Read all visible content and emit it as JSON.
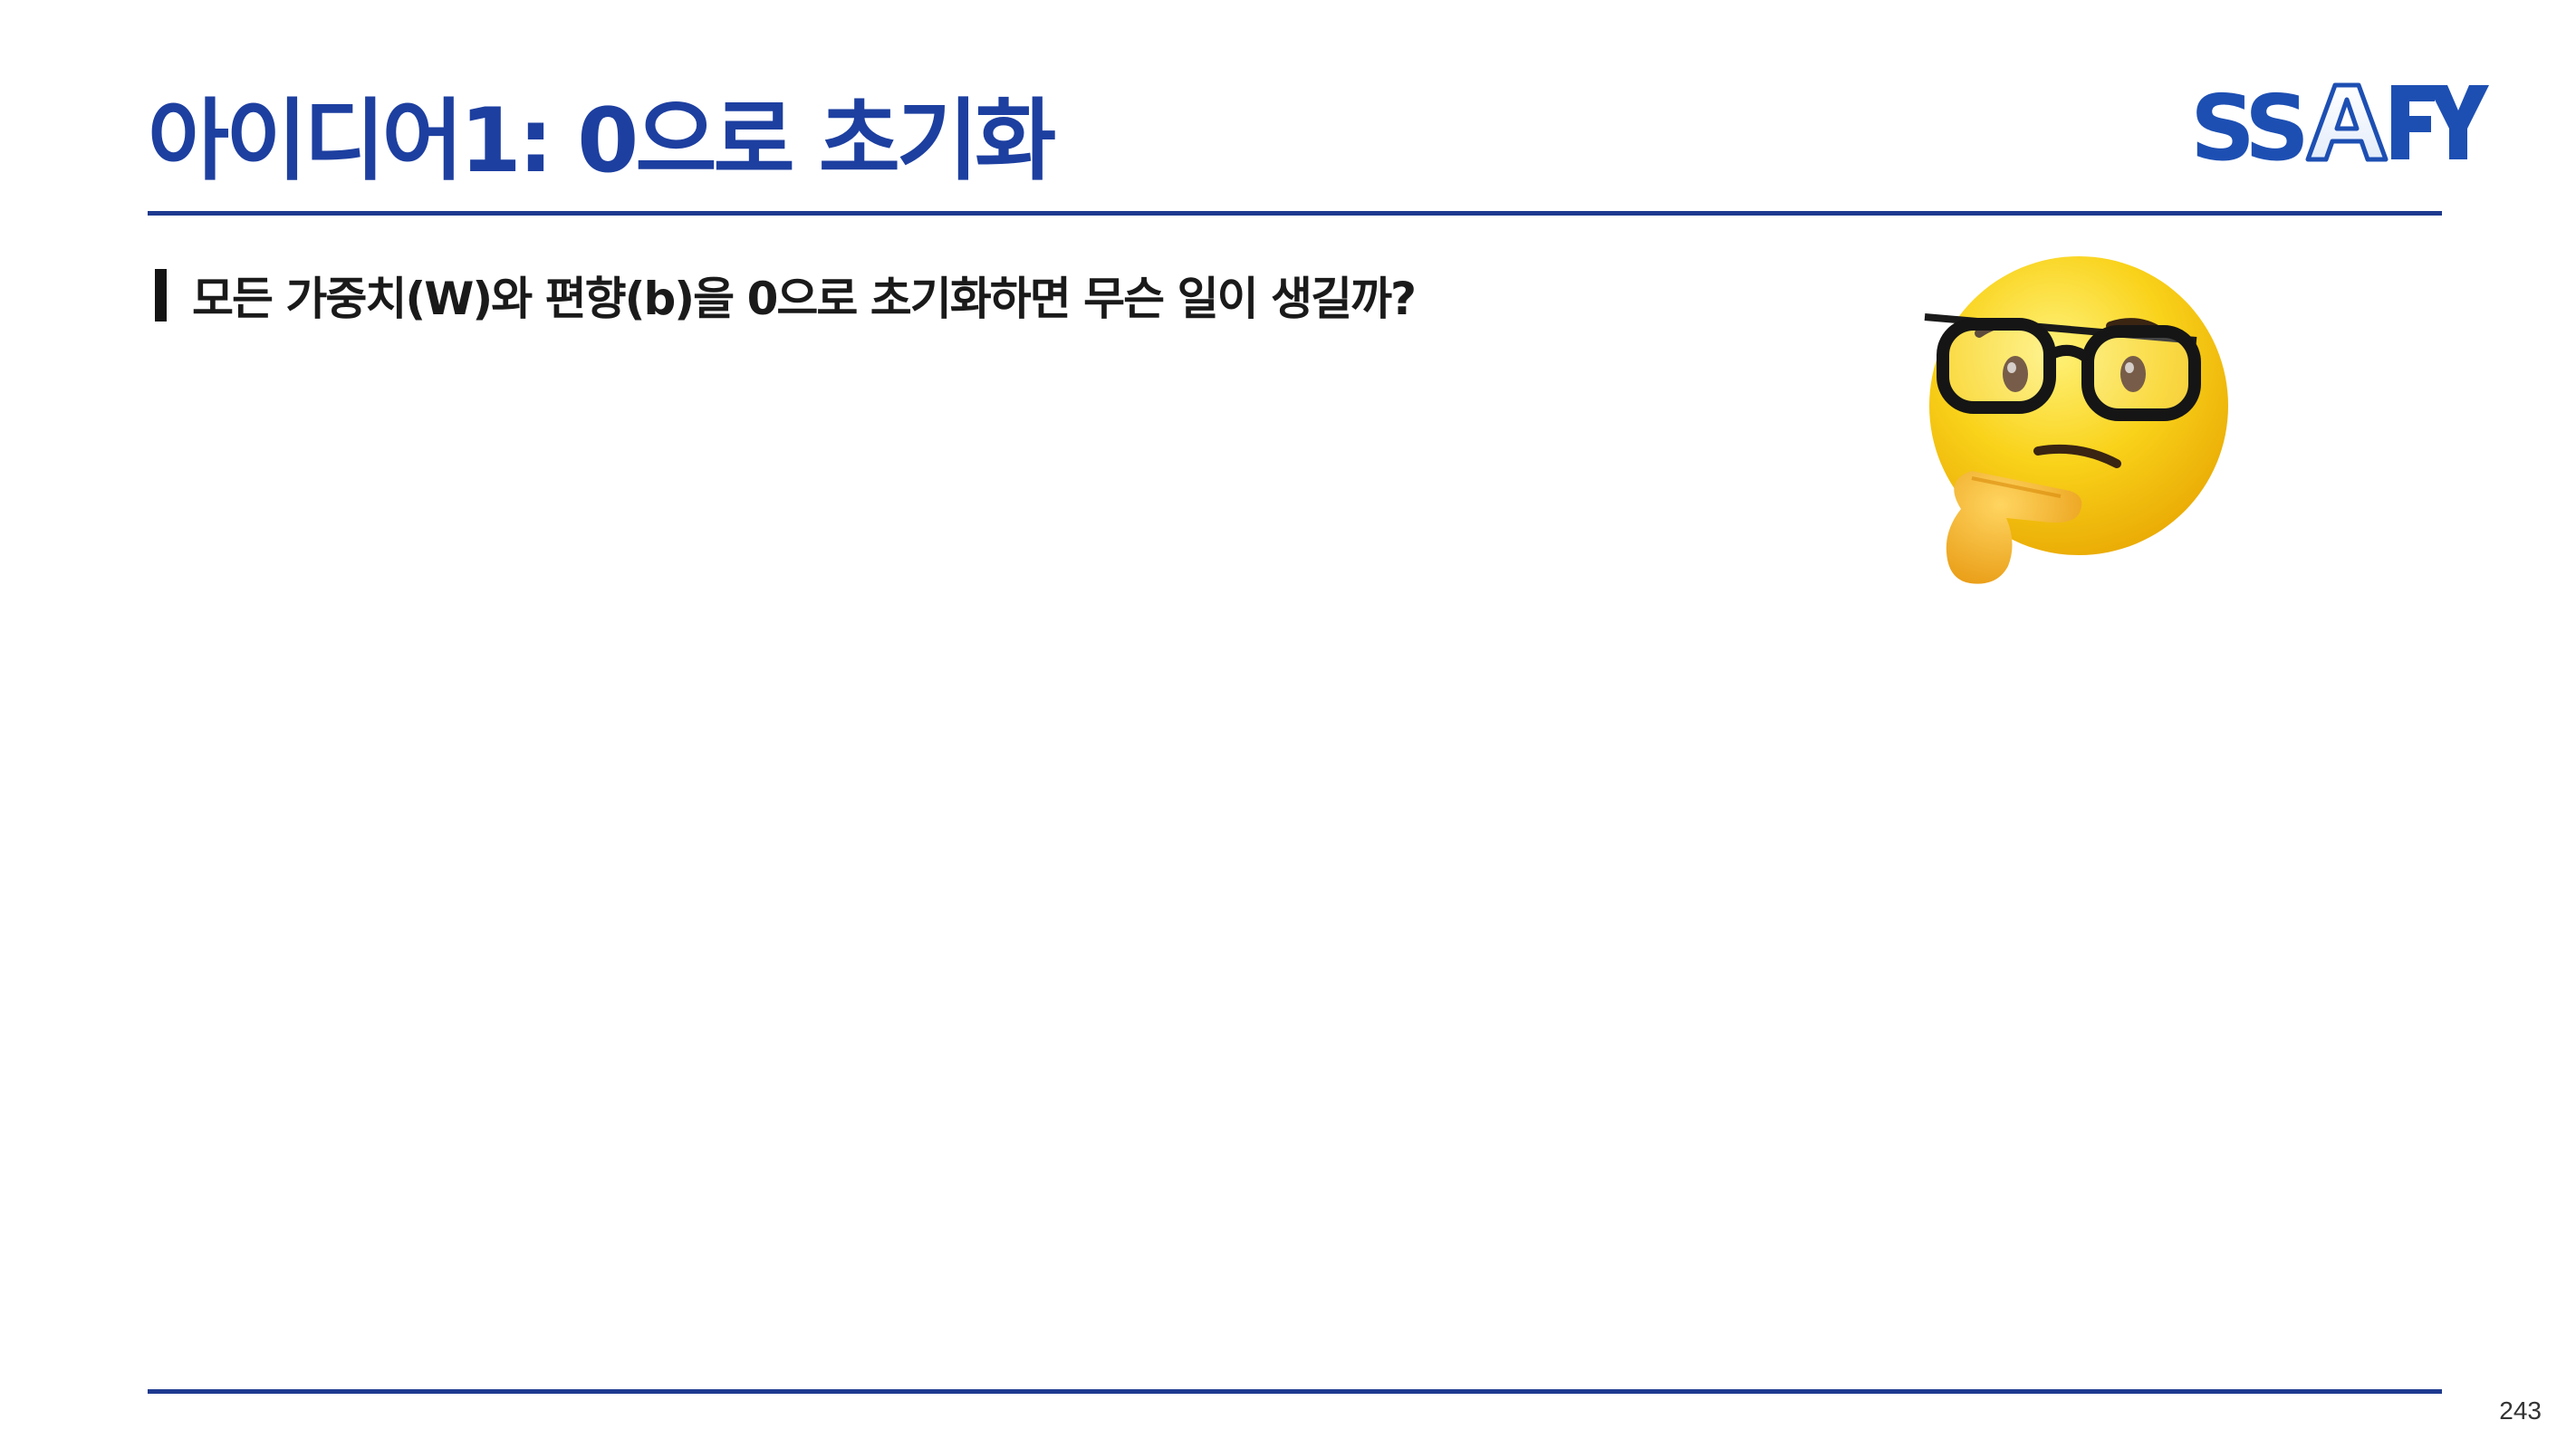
{
  "slide": {
    "title": "아이디어1: 0으로 초기화",
    "bullet": "모든 가중치(W)와 편향(b)을 0으로 초기화하면 무슨 일이 생길까?",
    "page_number": "243"
  },
  "logo": {
    "text": "SSAFY",
    "color": "#1d4fb3"
  },
  "icons": {
    "emoji": "thinking-face-with-glasses-icon"
  },
  "colors": {
    "title": "#1d3fa0",
    "rule": "#1e3a8f",
    "text": "#1a1a1a"
  }
}
